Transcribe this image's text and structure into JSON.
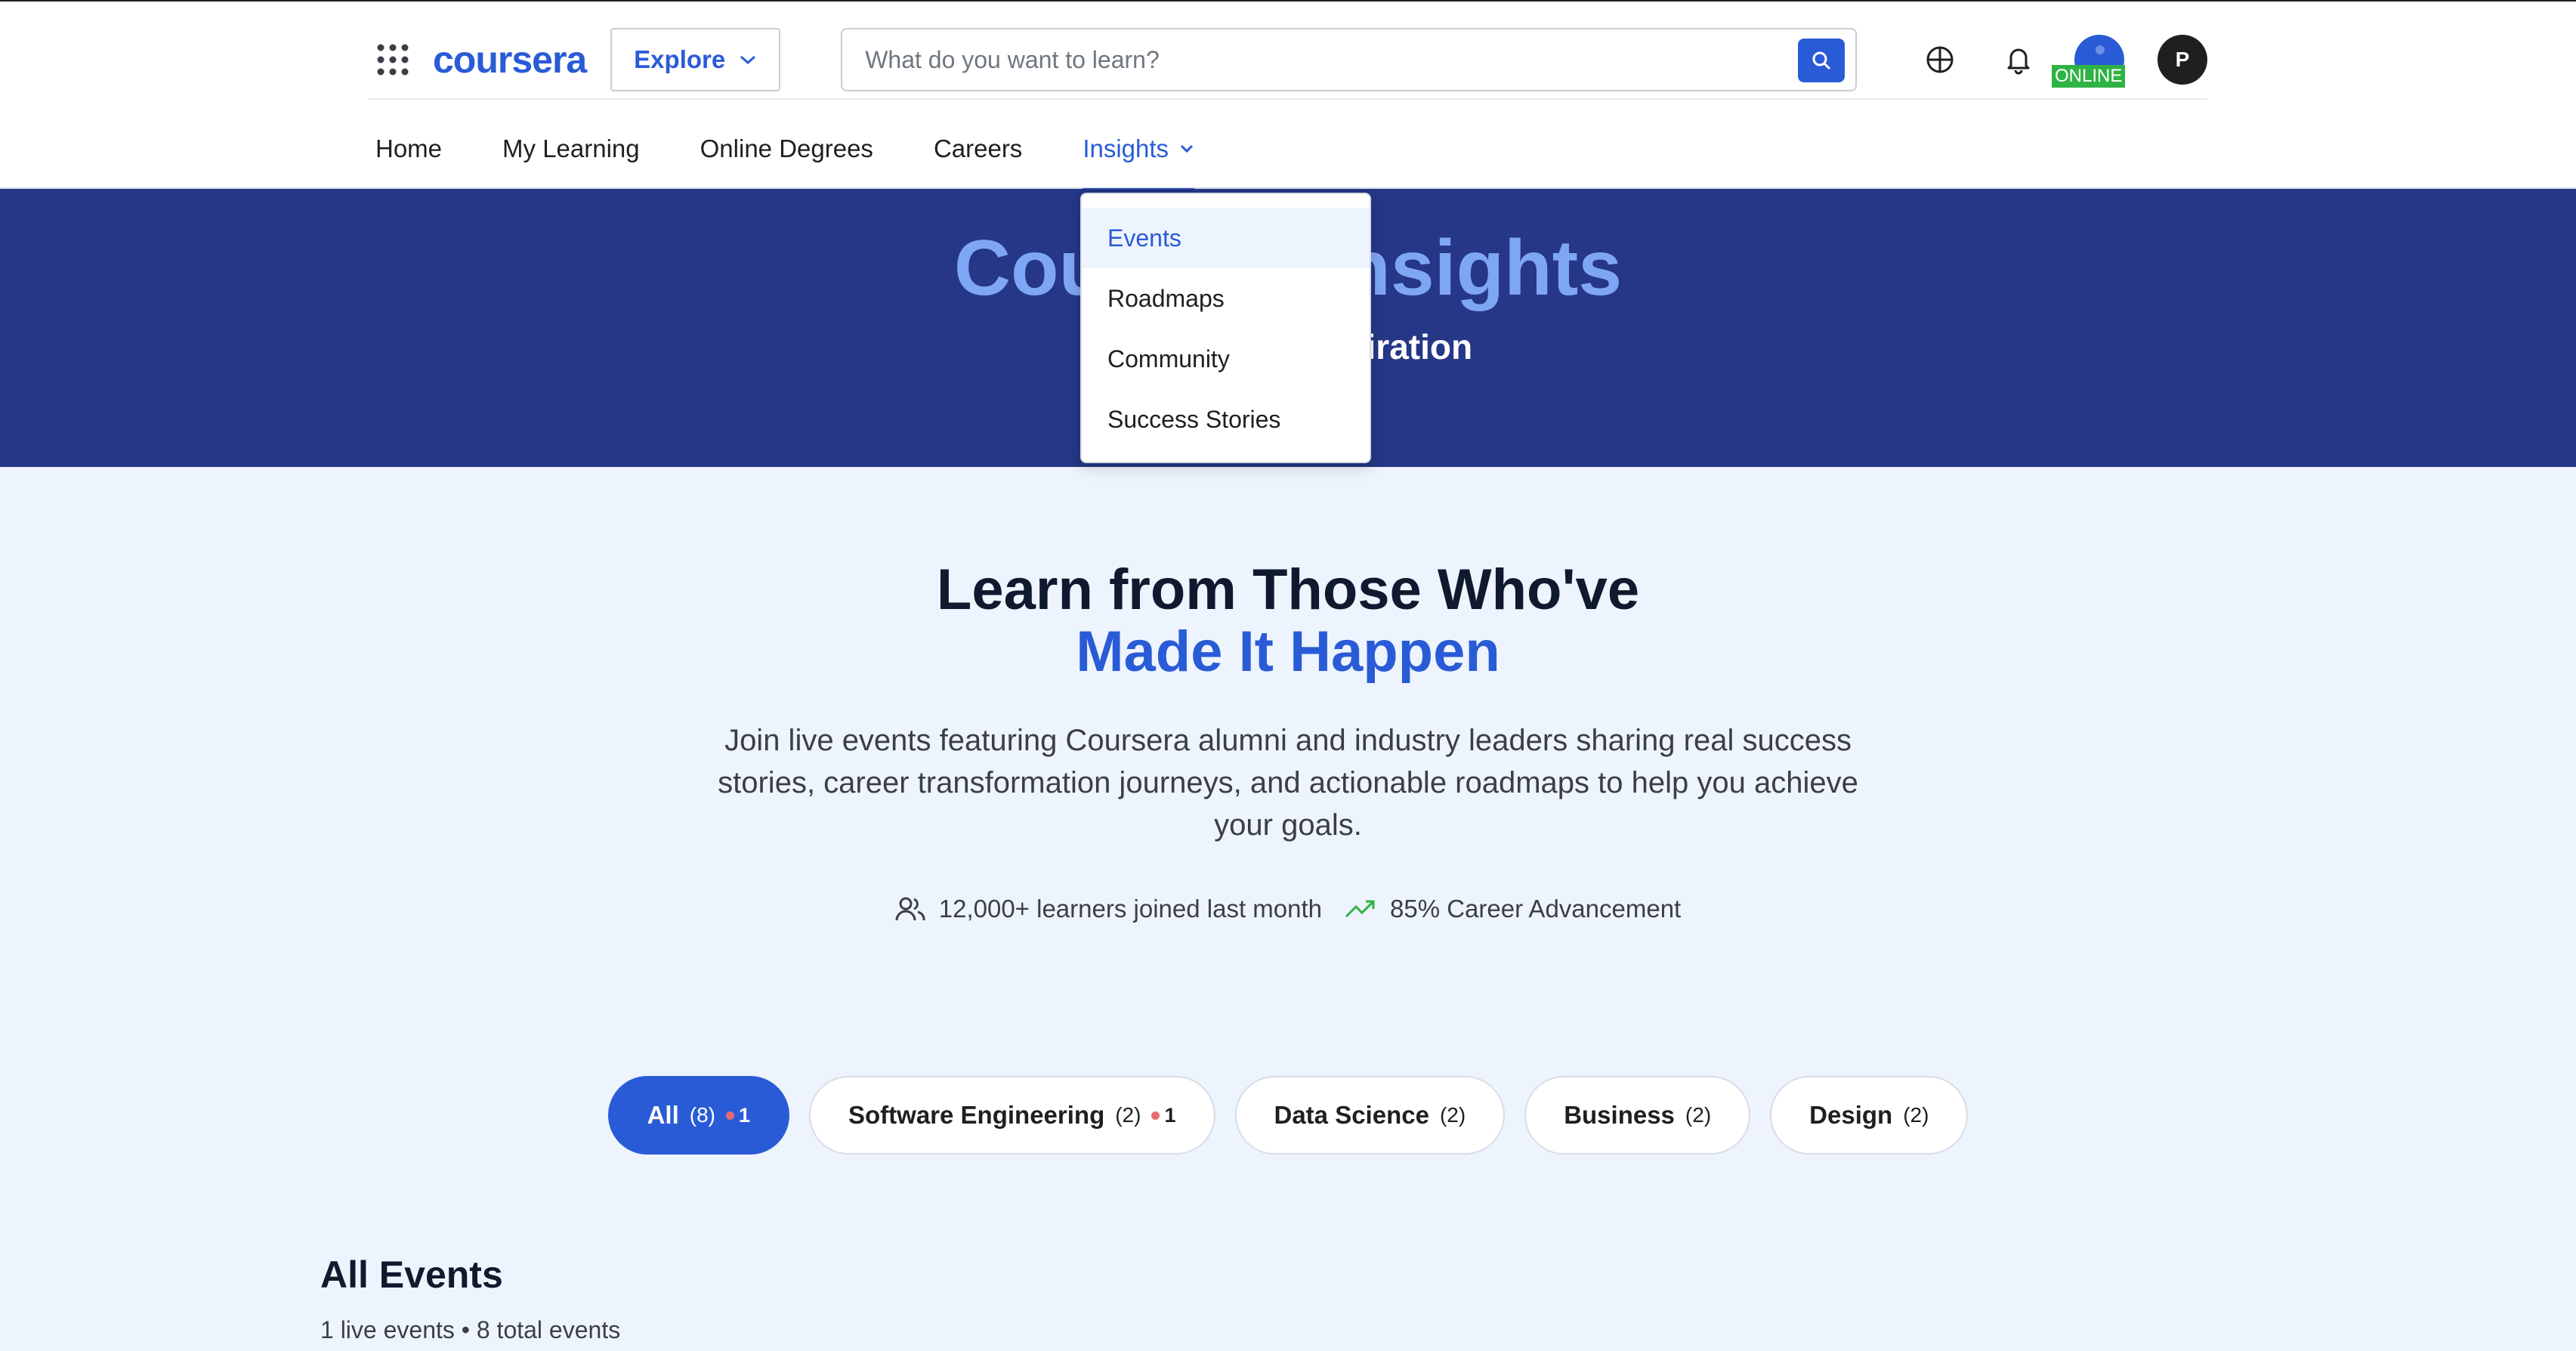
{
  "header": {
    "logo": "coursera",
    "explore_label": "Explore",
    "search_placeholder": "What do you want to learn?",
    "online_badge": "ONLINE",
    "avatar_initial": "P"
  },
  "nav": {
    "items": [
      {
        "label": "Home"
      },
      {
        "label": "My Learning"
      },
      {
        "label": "Online Degrees"
      },
      {
        "label": "Careers"
      },
      {
        "label": "Insights",
        "active": true
      }
    ]
  },
  "dropdown": {
    "items": [
      {
        "label": "Events",
        "active": true
      },
      {
        "label": "Roadmaps"
      },
      {
        "label": "Community"
      },
      {
        "label": "Success Stories"
      }
    ]
  },
  "banner": {
    "title": "Coursera Insights",
    "subtitle": "Learn from Inspiration"
  },
  "hero": {
    "headline": "Learn from Those Who've",
    "headline_accent": "Made It Happen",
    "intro": "Join live events featuring Coursera alumni and industry leaders sharing real success stories, career transformation journeys, and actionable roadmaps to help you achieve your goals.",
    "stats": [
      {
        "icon": "users-icon",
        "text": "12,000+ learners joined last month"
      },
      {
        "icon": "trending-up-icon",
        "text": "85% Career Advancement"
      }
    ]
  },
  "filters": [
    {
      "label": "All",
      "count": "(8)",
      "live": "1",
      "active": true
    },
    {
      "label": "Software Engineering",
      "count": "(2)",
      "live": "1"
    },
    {
      "label": "Data Science",
      "count": "(2)"
    },
    {
      "label": "Business",
      "count": "(2)"
    },
    {
      "label": "Design",
      "count": "(2)"
    }
  ],
  "events": {
    "title": "All Events",
    "summary": "1 live events • 8 total events"
  },
  "colors": {
    "brand": "#2a5bd7",
    "banner_bg": "#253786",
    "banner_title": "#7fa6f4",
    "page_bg": "#eef4fd",
    "online_green": "#2fb344",
    "live_dot": "#e86b73"
  }
}
